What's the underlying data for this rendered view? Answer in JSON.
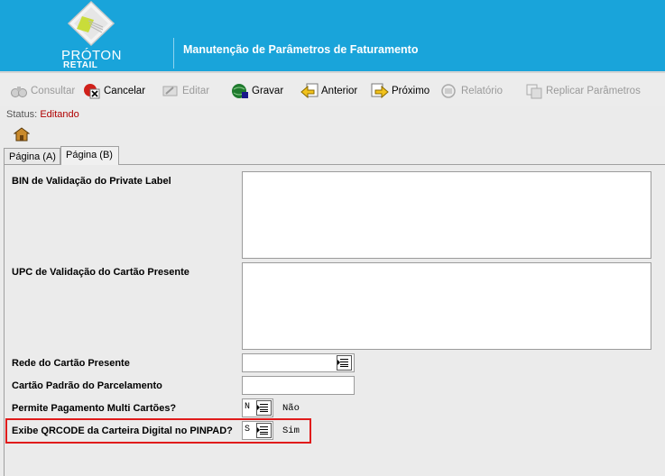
{
  "header": {
    "logo_name": "PRÓTON",
    "logo_sub": "RETAIL",
    "title": "Manutenção de Parâmetros de Faturamento"
  },
  "toolbar": {
    "consultar": "Consultar",
    "cancelar": "Cancelar",
    "editar": "Editar",
    "gravar": "Gravar",
    "anterior": "Anterior",
    "proximo": "Próximo",
    "relatorio": "Relatório",
    "replicar": "Replicar Parâmetros"
  },
  "status": {
    "label": "Status:",
    "value": "Editando"
  },
  "tabs": [
    {
      "label": "Página (A)"
    },
    {
      "label": "Página (B)"
    }
  ],
  "form": {
    "bin_label": "BIN de Validação do Private Label",
    "upc_label": "UPC de Validação do Cartão Presente",
    "rede_label": "Rede do Cartão Presente",
    "cartao_padrao_label": "Cartão Padrão do Parcelamento",
    "multi_label": "Permite Pagamento Multi Cartões?",
    "multi_value": "N",
    "multi_desc": "Não",
    "qrcode_label": "Exibe QRCODE da Carteira Digital no PINPAD?",
    "qrcode_value": "S",
    "qrcode_desc": "Sim"
  },
  "colors": {
    "header_bg": "#19a4da",
    "status_value": "#b00000",
    "highlight": "#e01b1b"
  }
}
